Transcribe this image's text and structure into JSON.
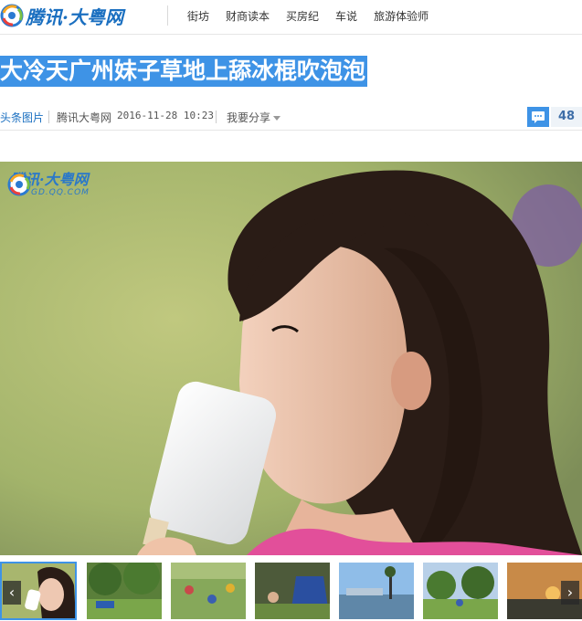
{
  "header": {
    "logo_text": "腾讯·大粤网",
    "nav": [
      "街坊",
      "财商读本",
      "买房纪",
      "车说",
      "旅游体验师"
    ]
  },
  "article": {
    "title": "大冷天广州妹子草地上舔冰棍吹泡泡",
    "source_label": "头条图片",
    "media": "腾讯大粤网",
    "time": "2016-11-28 10:23",
    "share_label": "我要分享",
    "comment_count": "48"
  },
  "photo": {
    "watermark": "腾讯·大粤网",
    "watermark_sub": "GD.QQ.COM",
    "icon": "photo"
  },
  "thumbnails": {
    "prev_label": "‹",
    "next_label": "›",
    "count": 7
  },
  "colors": {
    "accent": "#3e93e6",
    "brand": "#1a6fc0"
  }
}
